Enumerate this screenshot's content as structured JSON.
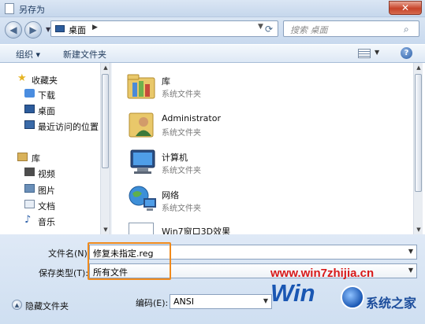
{
  "window": {
    "title": "另存为",
    "close_label": "✕"
  },
  "nav": {
    "back_icon": "back-arrow-icon",
    "forward_icon": "forward-arrow-icon",
    "address": "桌面",
    "search_placeholder": "搜索 桌面"
  },
  "toolbar": {
    "organize": "组织 ▾",
    "new_folder": "新建文件夹",
    "help": "?"
  },
  "sidebar": {
    "favorites_label": "收藏夹",
    "favorites": [
      "下载",
      "桌面",
      "最近访问的位置"
    ],
    "libraries_label": "库",
    "libraries": [
      "视频",
      "图片",
      "文档",
      "音乐"
    ]
  },
  "files": [
    {
      "name": "库",
      "type": "系统文件夹",
      "icon": "library-folder-icon"
    },
    {
      "name": "Administrator",
      "type": "系统文件夹",
      "icon": "user-folder-icon"
    },
    {
      "name": "计算机",
      "type": "系统文件夹",
      "icon": "computer-icon"
    },
    {
      "name": "网络",
      "type": "系统文件夹",
      "icon": "network-icon"
    },
    {
      "name": "Win7窗口3D效果",
      "type": "",
      "icon": "file-icon"
    }
  ],
  "form": {
    "filename_label": "文件名(N):",
    "filename_value": "修复未指定.reg",
    "filetype_label": "保存类型(T):",
    "filetype_value": "所有文件",
    "encoding_label": "编码(E):",
    "encoding_value": "ANSI",
    "hide_folders": "隐藏文件夹"
  },
  "watermark": {
    "url": "www.win7zhijia.cn",
    "big": "Win",
    "cn": "系统之家"
  },
  "colors": {
    "highlight": "#f08a1c",
    "watermark_red": "#d81a1a",
    "watermark_blue": "#1a57b3"
  }
}
